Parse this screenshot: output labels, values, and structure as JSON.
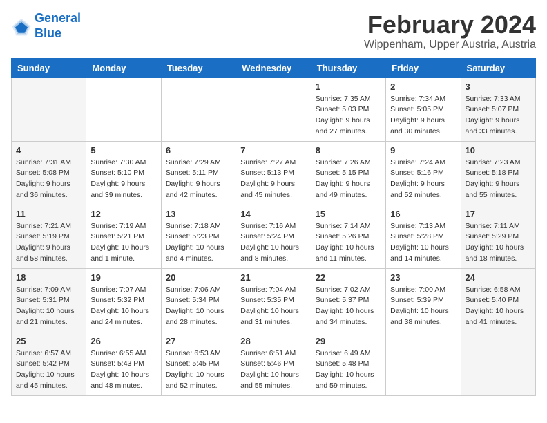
{
  "header": {
    "logo_line1": "General",
    "logo_line2": "Blue",
    "month": "February 2024",
    "location": "Wippenham, Upper Austria, Austria"
  },
  "days_of_week": [
    "Sunday",
    "Monday",
    "Tuesday",
    "Wednesday",
    "Thursday",
    "Friday",
    "Saturday"
  ],
  "weeks": [
    [
      {
        "day": "",
        "info": ""
      },
      {
        "day": "",
        "info": ""
      },
      {
        "day": "",
        "info": ""
      },
      {
        "day": "",
        "info": ""
      },
      {
        "day": "1",
        "info": "Sunrise: 7:35 AM\nSunset: 5:03 PM\nDaylight: 9 hours\nand 27 minutes."
      },
      {
        "day": "2",
        "info": "Sunrise: 7:34 AM\nSunset: 5:05 PM\nDaylight: 9 hours\nand 30 minutes."
      },
      {
        "day": "3",
        "info": "Sunrise: 7:33 AM\nSunset: 5:07 PM\nDaylight: 9 hours\nand 33 minutes."
      }
    ],
    [
      {
        "day": "4",
        "info": "Sunrise: 7:31 AM\nSunset: 5:08 PM\nDaylight: 9 hours\nand 36 minutes."
      },
      {
        "day": "5",
        "info": "Sunrise: 7:30 AM\nSunset: 5:10 PM\nDaylight: 9 hours\nand 39 minutes."
      },
      {
        "day": "6",
        "info": "Sunrise: 7:29 AM\nSunset: 5:11 PM\nDaylight: 9 hours\nand 42 minutes."
      },
      {
        "day": "7",
        "info": "Sunrise: 7:27 AM\nSunset: 5:13 PM\nDaylight: 9 hours\nand 45 minutes."
      },
      {
        "day": "8",
        "info": "Sunrise: 7:26 AM\nSunset: 5:15 PM\nDaylight: 9 hours\nand 49 minutes."
      },
      {
        "day": "9",
        "info": "Sunrise: 7:24 AM\nSunset: 5:16 PM\nDaylight: 9 hours\nand 52 minutes."
      },
      {
        "day": "10",
        "info": "Sunrise: 7:23 AM\nSunset: 5:18 PM\nDaylight: 9 hours\nand 55 minutes."
      }
    ],
    [
      {
        "day": "11",
        "info": "Sunrise: 7:21 AM\nSunset: 5:19 PM\nDaylight: 9 hours\nand 58 minutes."
      },
      {
        "day": "12",
        "info": "Sunrise: 7:19 AM\nSunset: 5:21 PM\nDaylight: 10 hours\nand 1 minute."
      },
      {
        "day": "13",
        "info": "Sunrise: 7:18 AM\nSunset: 5:23 PM\nDaylight: 10 hours\nand 4 minutes."
      },
      {
        "day": "14",
        "info": "Sunrise: 7:16 AM\nSunset: 5:24 PM\nDaylight: 10 hours\nand 8 minutes."
      },
      {
        "day": "15",
        "info": "Sunrise: 7:14 AM\nSunset: 5:26 PM\nDaylight: 10 hours\nand 11 minutes."
      },
      {
        "day": "16",
        "info": "Sunrise: 7:13 AM\nSunset: 5:28 PM\nDaylight: 10 hours\nand 14 minutes."
      },
      {
        "day": "17",
        "info": "Sunrise: 7:11 AM\nSunset: 5:29 PM\nDaylight: 10 hours\nand 18 minutes."
      }
    ],
    [
      {
        "day": "18",
        "info": "Sunrise: 7:09 AM\nSunset: 5:31 PM\nDaylight: 10 hours\nand 21 minutes."
      },
      {
        "day": "19",
        "info": "Sunrise: 7:07 AM\nSunset: 5:32 PM\nDaylight: 10 hours\nand 24 minutes."
      },
      {
        "day": "20",
        "info": "Sunrise: 7:06 AM\nSunset: 5:34 PM\nDaylight: 10 hours\nand 28 minutes."
      },
      {
        "day": "21",
        "info": "Sunrise: 7:04 AM\nSunset: 5:35 PM\nDaylight: 10 hours\nand 31 minutes."
      },
      {
        "day": "22",
        "info": "Sunrise: 7:02 AM\nSunset: 5:37 PM\nDaylight: 10 hours\nand 34 minutes."
      },
      {
        "day": "23",
        "info": "Sunrise: 7:00 AM\nSunset: 5:39 PM\nDaylight: 10 hours\nand 38 minutes."
      },
      {
        "day": "24",
        "info": "Sunrise: 6:58 AM\nSunset: 5:40 PM\nDaylight: 10 hours\nand 41 minutes."
      }
    ],
    [
      {
        "day": "25",
        "info": "Sunrise: 6:57 AM\nSunset: 5:42 PM\nDaylight: 10 hours\nand 45 minutes."
      },
      {
        "day": "26",
        "info": "Sunrise: 6:55 AM\nSunset: 5:43 PM\nDaylight: 10 hours\nand 48 minutes."
      },
      {
        "day": "27",
        "info": "Sunrise: 6:53 AM\nSunset: 5:45 PM\nDaylight: 10 hours\nand 52 minutes."
      },
      {
        "day": "28",
        "info": "Sunrise: 6:51 AM\nSunset: 5:46 PM\nDaylight: 10 hours\nand 55 minutes."
      },
      {
        "day": "29",
        "info": "Sunrise: 6:49 AM\nSunset: 5:48 PM\nDaylight: 10 hours\nand 59 minutes."
      },
      {
        "day": "",
        "info": ""
      },
      {
        "day": "",
        "info": ""
      }
    ]
  ]
}
